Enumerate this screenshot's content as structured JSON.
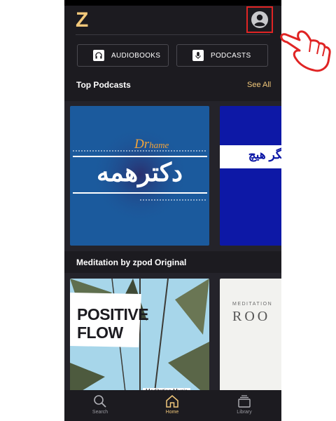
{
  "app": {
    "logo": "Z"
  },
  "header": {
    "profile_icon": "user-circle-icon"
  },
  "chips": [
    {
      "label": "AUDIOBOOKS",
      "icon": "headphones-icon"
    },
    {
      "label": "PODCASTS",
      "icon": "microphone-icon"
    }
  ],
  "sections": [
    {
      "title": "Top Podcasts",
      "see_all": "See All",
      "cards": [
        {
          "title_top": "Dr",
          "title_top_italic": "hame",
          "title_main": "دکترهمه"
        },
        {
          "title_main": "بگر هیچ"
        }
      ]
    },
    {
      "title": "Meditation by zpod Original",
      "cards": [
        {
          "line1": "POSITIVE",
          "line2": "FLOW",
          "footer": "Meditation Music"
        },
        {
          "kicker": "MEDITATION",
          "title": "ROO"
        }
      ]
    }
  ],
  "bottom_nav": [
    {
      "label": "Search",
      "icon": "search-icon",
      "active": false
    },
    {
      "label": "Home",
      "icon": "home-icon",
      "active": true
    },
    {
      "label": "Library",
      "icon": "library-icon",
      "active": false
    }
  ],
  "colors": {
    "background": "#1c1b20",
    "accent": "#f2c87a",
    "highlight": "#e02424"
  }
}
